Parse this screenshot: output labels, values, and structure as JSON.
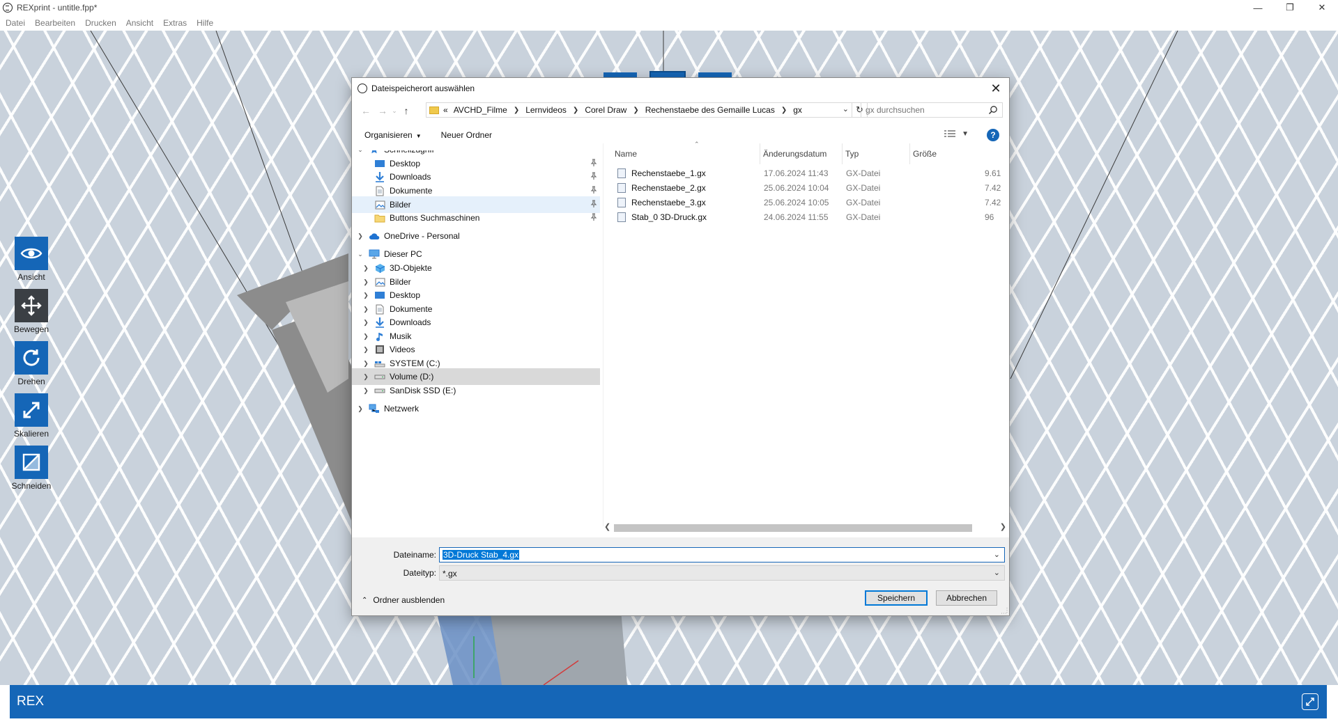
{
  "window": {
    "title": "REXprint - untitle.fpp*",
    "controls": [
      "—",
      "❐",
      "✕"
    ]
  },
  "menu": [
    "Datei",
    "Bearbeiten",
    "Drucken",
    "Ansicht",
    "Extras",
    "Hilfe"
  ],
  "side_tools": [
    {
      "label": "Ansicht",
      "icon": "eye-icon"
    },
    {
      "label": "Bewegen",
      "icon": "move-icon"
    },
    {
      "label": "Drehen",
      "icon": "rotate-icon"
    },
    {
      "label": "Skalieren",
      "icon": "scale-icon"
    },
    {
      "label": "Schneiden",
      "icon": "cut-icon"
    }
  ],
  "top_tools": [
    "new-file-icon",
    "edit-icon",
    "print-icon"
  ],
  "statusbar": {
    "text": "REX"
  },
  "dialog": {
    "title": "Dateispeicherort auswählen",
    "breadcrumbs": [
      "«",
      "AVCHD_Filme",
      "Lernvideos",
      "Corel Draw",
      "Rechenstaebe des Gemaille Lucas",
      "gx"
    ],
    "search_placeholder": "gx durchsuchen",
    "organize_label": "Organisieren",
    "new_folder_label": "Neuer Ordner",
    "help_label": "?",
    "nav_items": [
      {
        "label": "Schnellzugriff",
        "icon": "star-icon",
        "level": 0,
        "twisty": "v",
        "pinned": false,
        "state": ""
      },
      {
        "label": "Desktop",
        "icon": "desktop-icon",
        "level": 1,
        "twisty": "",
        "pinned": true,
        "state": ""
      },
      {
        "label": "Downloads",
        "icon": "download-icon",
        "level": 1,
        "twisty": "",
        "pinned": true,
        "state": ""
      },
      {
        "label": "Dokumente",
        "icon": "document-icon",
        "level": 1,
        "twisty": "",
        "pinned": true,
        "state": ""
      },
      {
        "label": "Bilder",
        "icon": "pictures-icon",
        "level": 1,
        "twisty": "",
        "pinned": true,
        "state": "selected"
      },
      {
        "label": "Buttons Suchmaschinen",
        "icon": "folder-icon",
        "level": 1,
        "twisty": "",
        "pinned": true,
        "state": ""
      },
      {
        "label": "OneDrive - Personal",
        "icon": "cloud-icon",
        "level": 0,
        "twisty": ">",
        "pinned": false,
        "state": ""
      },
      {
        "label": "Dieser PC",
        "icon": "computer-icon",
        "level": 0,
        "twisty": "v",
        "pinned": false,
        "state": ""
      },
      {
        "label": "3D-Objekte",
        "icon": "cube-icon",
        "level": 1,
        "twisty": ">",
        "pinned": false,
        "state": ""
      },
      {
        "label": "Bilder",
        "icon": "pictures-icon",
        "level": 1,
        "twisty": ">",
        "pinned": false,
        "state": ""
      },
      {
        "label": "Desktop",
        "icon": "desktop-icon",
        "level": 1,
        "twisty": ">",
        "pinned": false,
        "state": ""
      },
      {
        "label": "Dokumente",
        "icon": "document-icon",
        "level": 1,
        "twisty": ">",
        "pinned": false,
        "state": ""
      },
      {
        "label": "Downloads",
        "icon": "download-icon",
        "level": 1,
        "twisty": ">",
        "pinned": false,
        "state": ""
      },
      {
        "label": "Musik",
        "icon": "music-icon",
        "level": 1,
        "twisty": ">",
        "pinned": false,
        "state": ""
      },
      {
        "label": "Videos",
        "icon": "video-icon",
        "level": 1,
        "twisty": ">",
        "pinned": false,
        "state": ""
      },
      {
        "label": "SYSTEM (C:)",
        "icon": "system-drive-icon",
        "level": 1,
        "twisty": ">",
        "pinned": false,
        "state": ""
      },
      {
        "label": "Volume (D:)",
        "icon": "drive-icon",
        "level": 1,
        "twisty": ">",
        "pinned": false,
        "state": "hover"
      },
      {
        "label": "SanDisk SSD (E:)",
        "icon": "drive-icon",
        "level": 1,
        "twisty": ">",
        "pinned": false,
        "state": ""
      },
      {
        "label": "Netzwerk",
        "icon": "network-icon",
        "level": 0,
        "twisty": ">",
        "pinned": false,
        "state": ""
      }
    ],
    "columns": [
      "Name",
      "Änderungsdatum",
      "Typ",
      "Größe"
    ],
    "files": [
      {
        "name": "Rechenstaebe_1.gx",
        "date": "17.06.2024 11:43",
        "type": "GX-Datei",
        "size": "9.61"
      },
      {
        "name": "Rechenstaebe_2.gx",
        "date": "25.06.2024 10:04",
        "type": "GX-Datei",
        "size": "7.42"
      },
      {
        "name": "Rechenstaebe_3.gx",
        "date": "25.06.2024 10:05",
        "type": "GX-Datei",
        "size": "7.42"
      },
      {
        "name": "Stab_0 3D-Druck.gx",
        "date": "24.06.2024 11:55",
        "type": "GX-Datei",
        "size": "96"
      }
    ],
    "filename_label": "Dateiname:",
    "filename_value": "3D-Druck Stab_4.gx",
    "filetype_label": "Dateityp:",
    "filetype_value": "*.gx",
    "hide_folders_label": "Ordner ausblenden",
    "save_label": "Speichern",
    "cancel_label": "Abbrechen"
  },
  "colors": {
    "accent": "#1566b7",
    "selection": "#0078d7",
    "viewport": "#c9d2dc"
  }
}
